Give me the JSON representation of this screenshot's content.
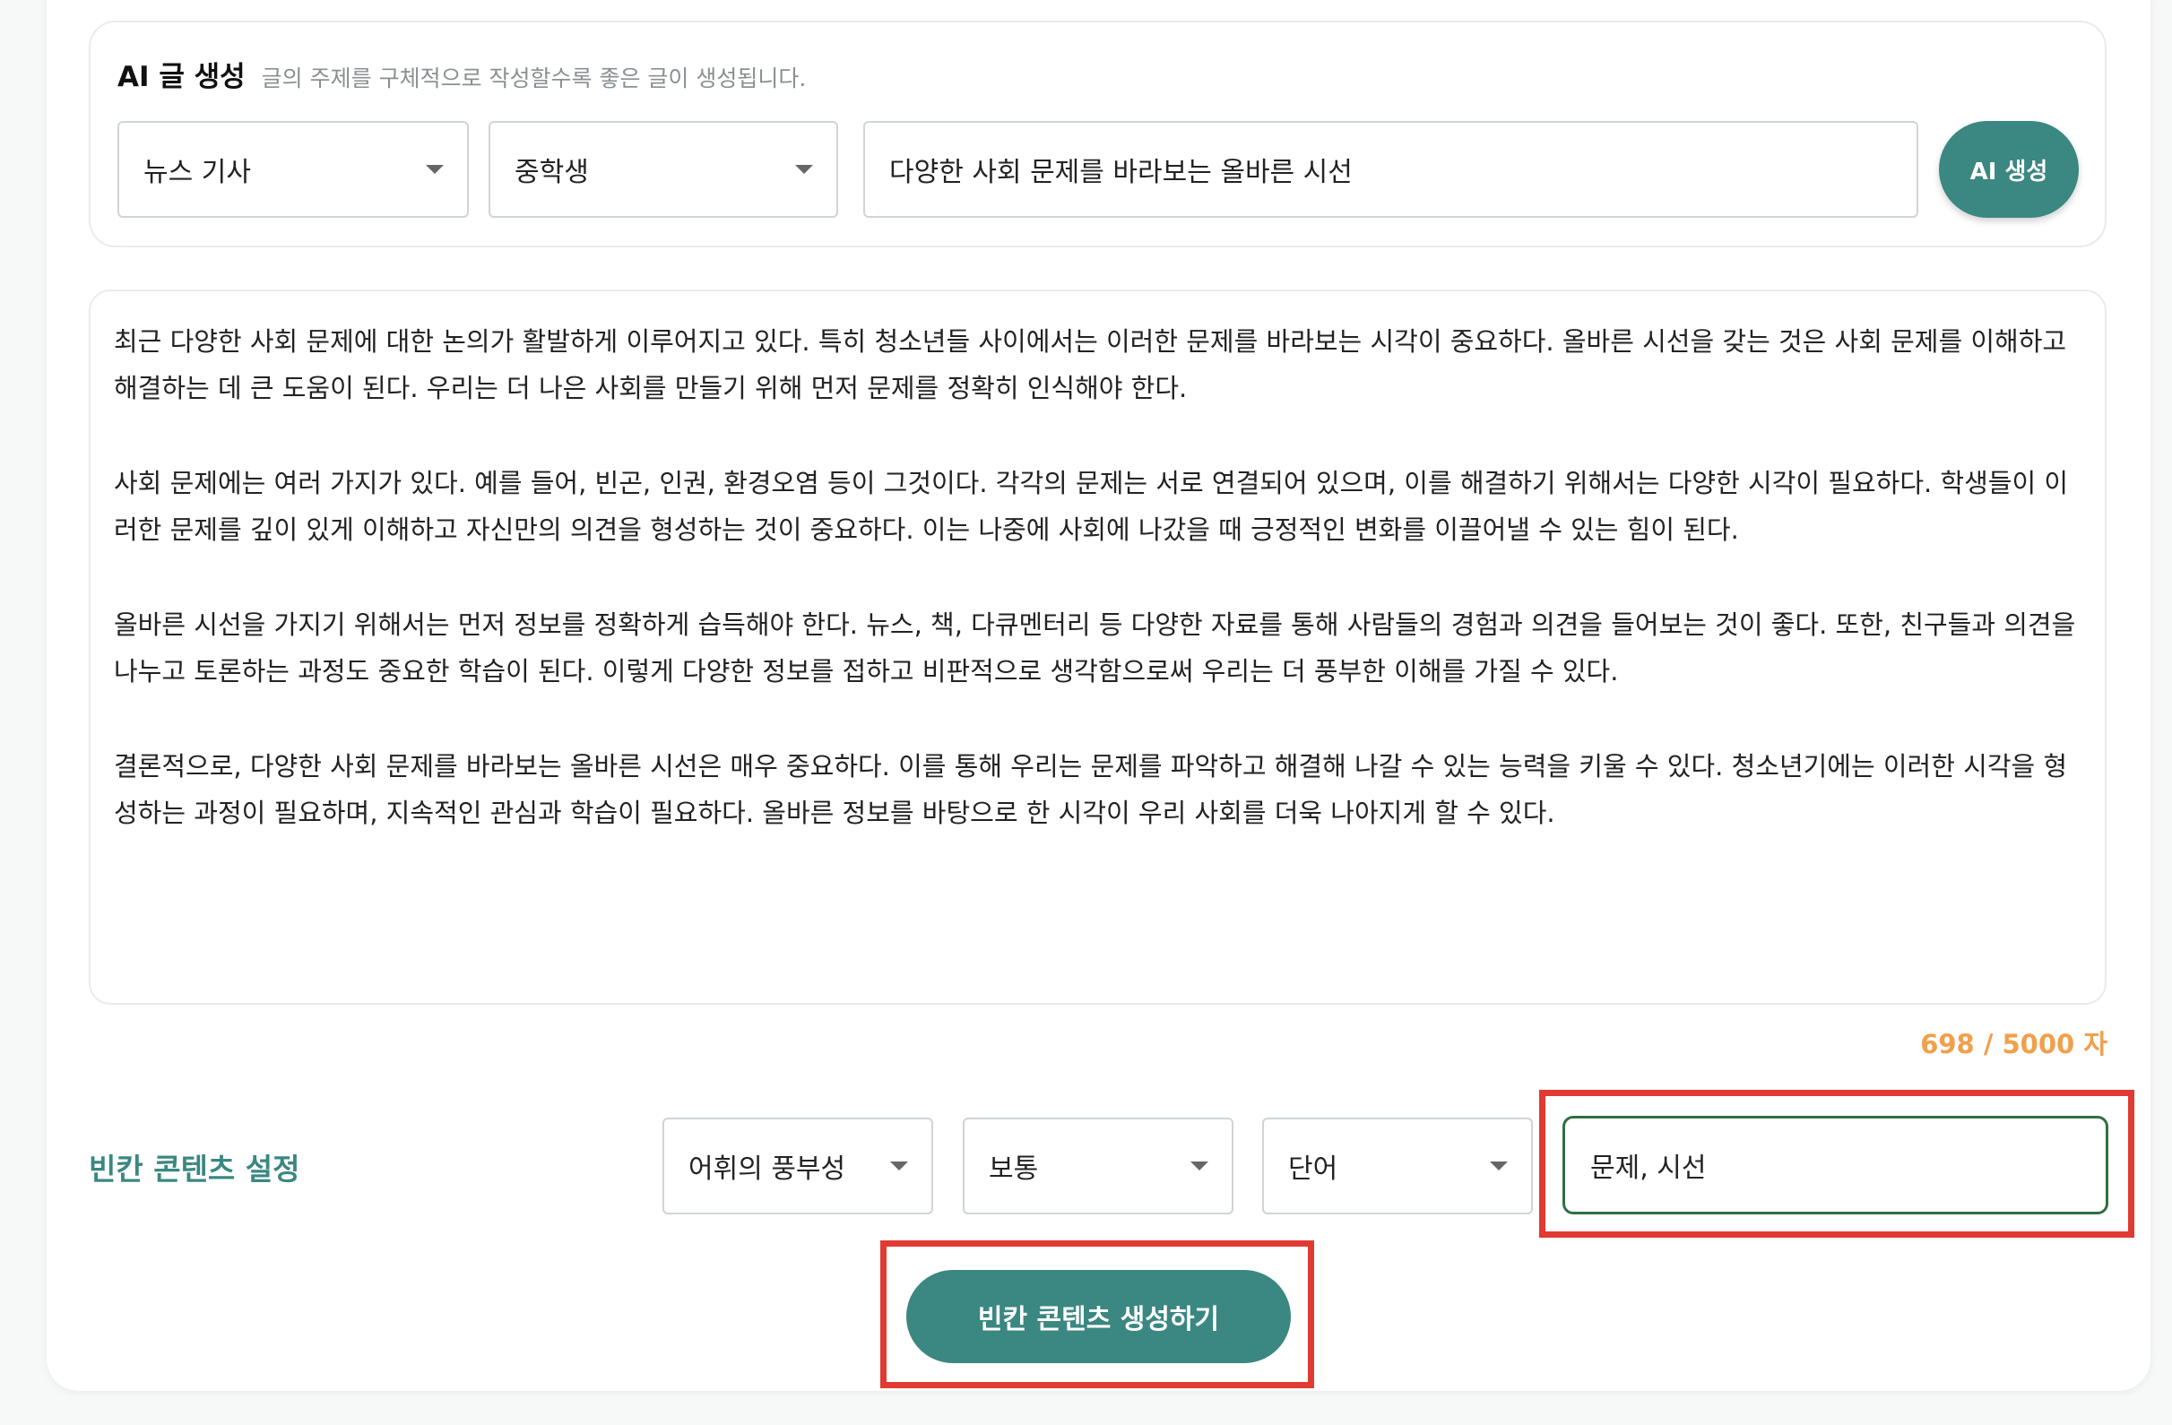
{
  "ai_generation": {
    "title": "AI 글 생성",
    "subtitle": "글의 주제를 구체적으로 작성할수록 좋은 글이 생성됩니다.",
    "genre_select": "뉴스 기사",
    "level_select": "중학생",
    "topic_value": "다양한 사회 문제를 바라보는 올바른 시선",
    "generate_button": "AI 생성"
  },
  "content": {
    "paragraphs": [
      "최근 다양한 사회 문제에 대한 논의가 활발하게 이루어지고 있다. 특히 청소년들 사이에서는 이러한 문제를 바라보는 시각이 중요하다. 올바른 시선을 갖는 것은 사회 문제를 이해하고 해결하는 데 큰 도움이 된다. 우리는 더 나은 사회를 만들기 위해 먼저 문제를 정확히 인식해야 한다.",
      "사회 문제에는 여러 가지가 있다. 예를 들어, 빈곤, 인권, 환경오염 등이 그것이다. 각각의 문제는 서로 연결되어 있으며, 이를 해결하기 위해서는 다양한 시각이 필요하다. 학생들이 이러한 문제를 깊이 있게 이해하고 자신만의 의견을 형성하는 것이 중요하다. 이는 나중에 사회에 나갔을 때 긍정적인 변화를 이끌어낼 수 있는 힘이 된다.",
      "올바른 시선을 가지기 위해서는 먼저 정보를 정확하게 습득해야 한다. 뉴스, 책, 다큐멘터리 등 다양한 자료를 통해 사람들의 경험과 의견을 들어보는 것이 좋다. 또한, 친구들과 의견을 나누고 토론하는 과정도 중요한 학습이 된다. 이렇게 다양한 정보를 접하고 비판적으로 생각함으로써 우리는 더 풍부한 이해를 가질 수 있다.",
      "결론적으로, 다양한 사회 문제를 바라보는 올바른 시선은 매우 중요하다. 이를 통해 우리는 문제를 파악하고 해결해 나갈 수 있는 능력을 키울 수 있다. 청소년기에는 이러한 시각을 형성하는 과정이 필요하며, 지속적인 관심과 학습이 필요하다. 올바른 정보를 바탕으로 한 시각이 우리 사회를 더욱 나아지게 할 수 있다."
    ],
    "char_count": "698 / 5000 자"
  },
  "blank_settings": {
    "label": "빈칸 콘텐츠 설정",
    "criteria_select": "어휘의 풍부성",
    "difficulty_select": "보통",
    "unit_select": "단어",
    "keywords_value": "문제, 시선",
    "generate_button": "빈칸 콘텐츠 생성하기"
  },
  "colors": {
    "accent": "#3b8781",
    "counter": "#f0a04b",
    "highlight": "#e13a33"
  }
}
